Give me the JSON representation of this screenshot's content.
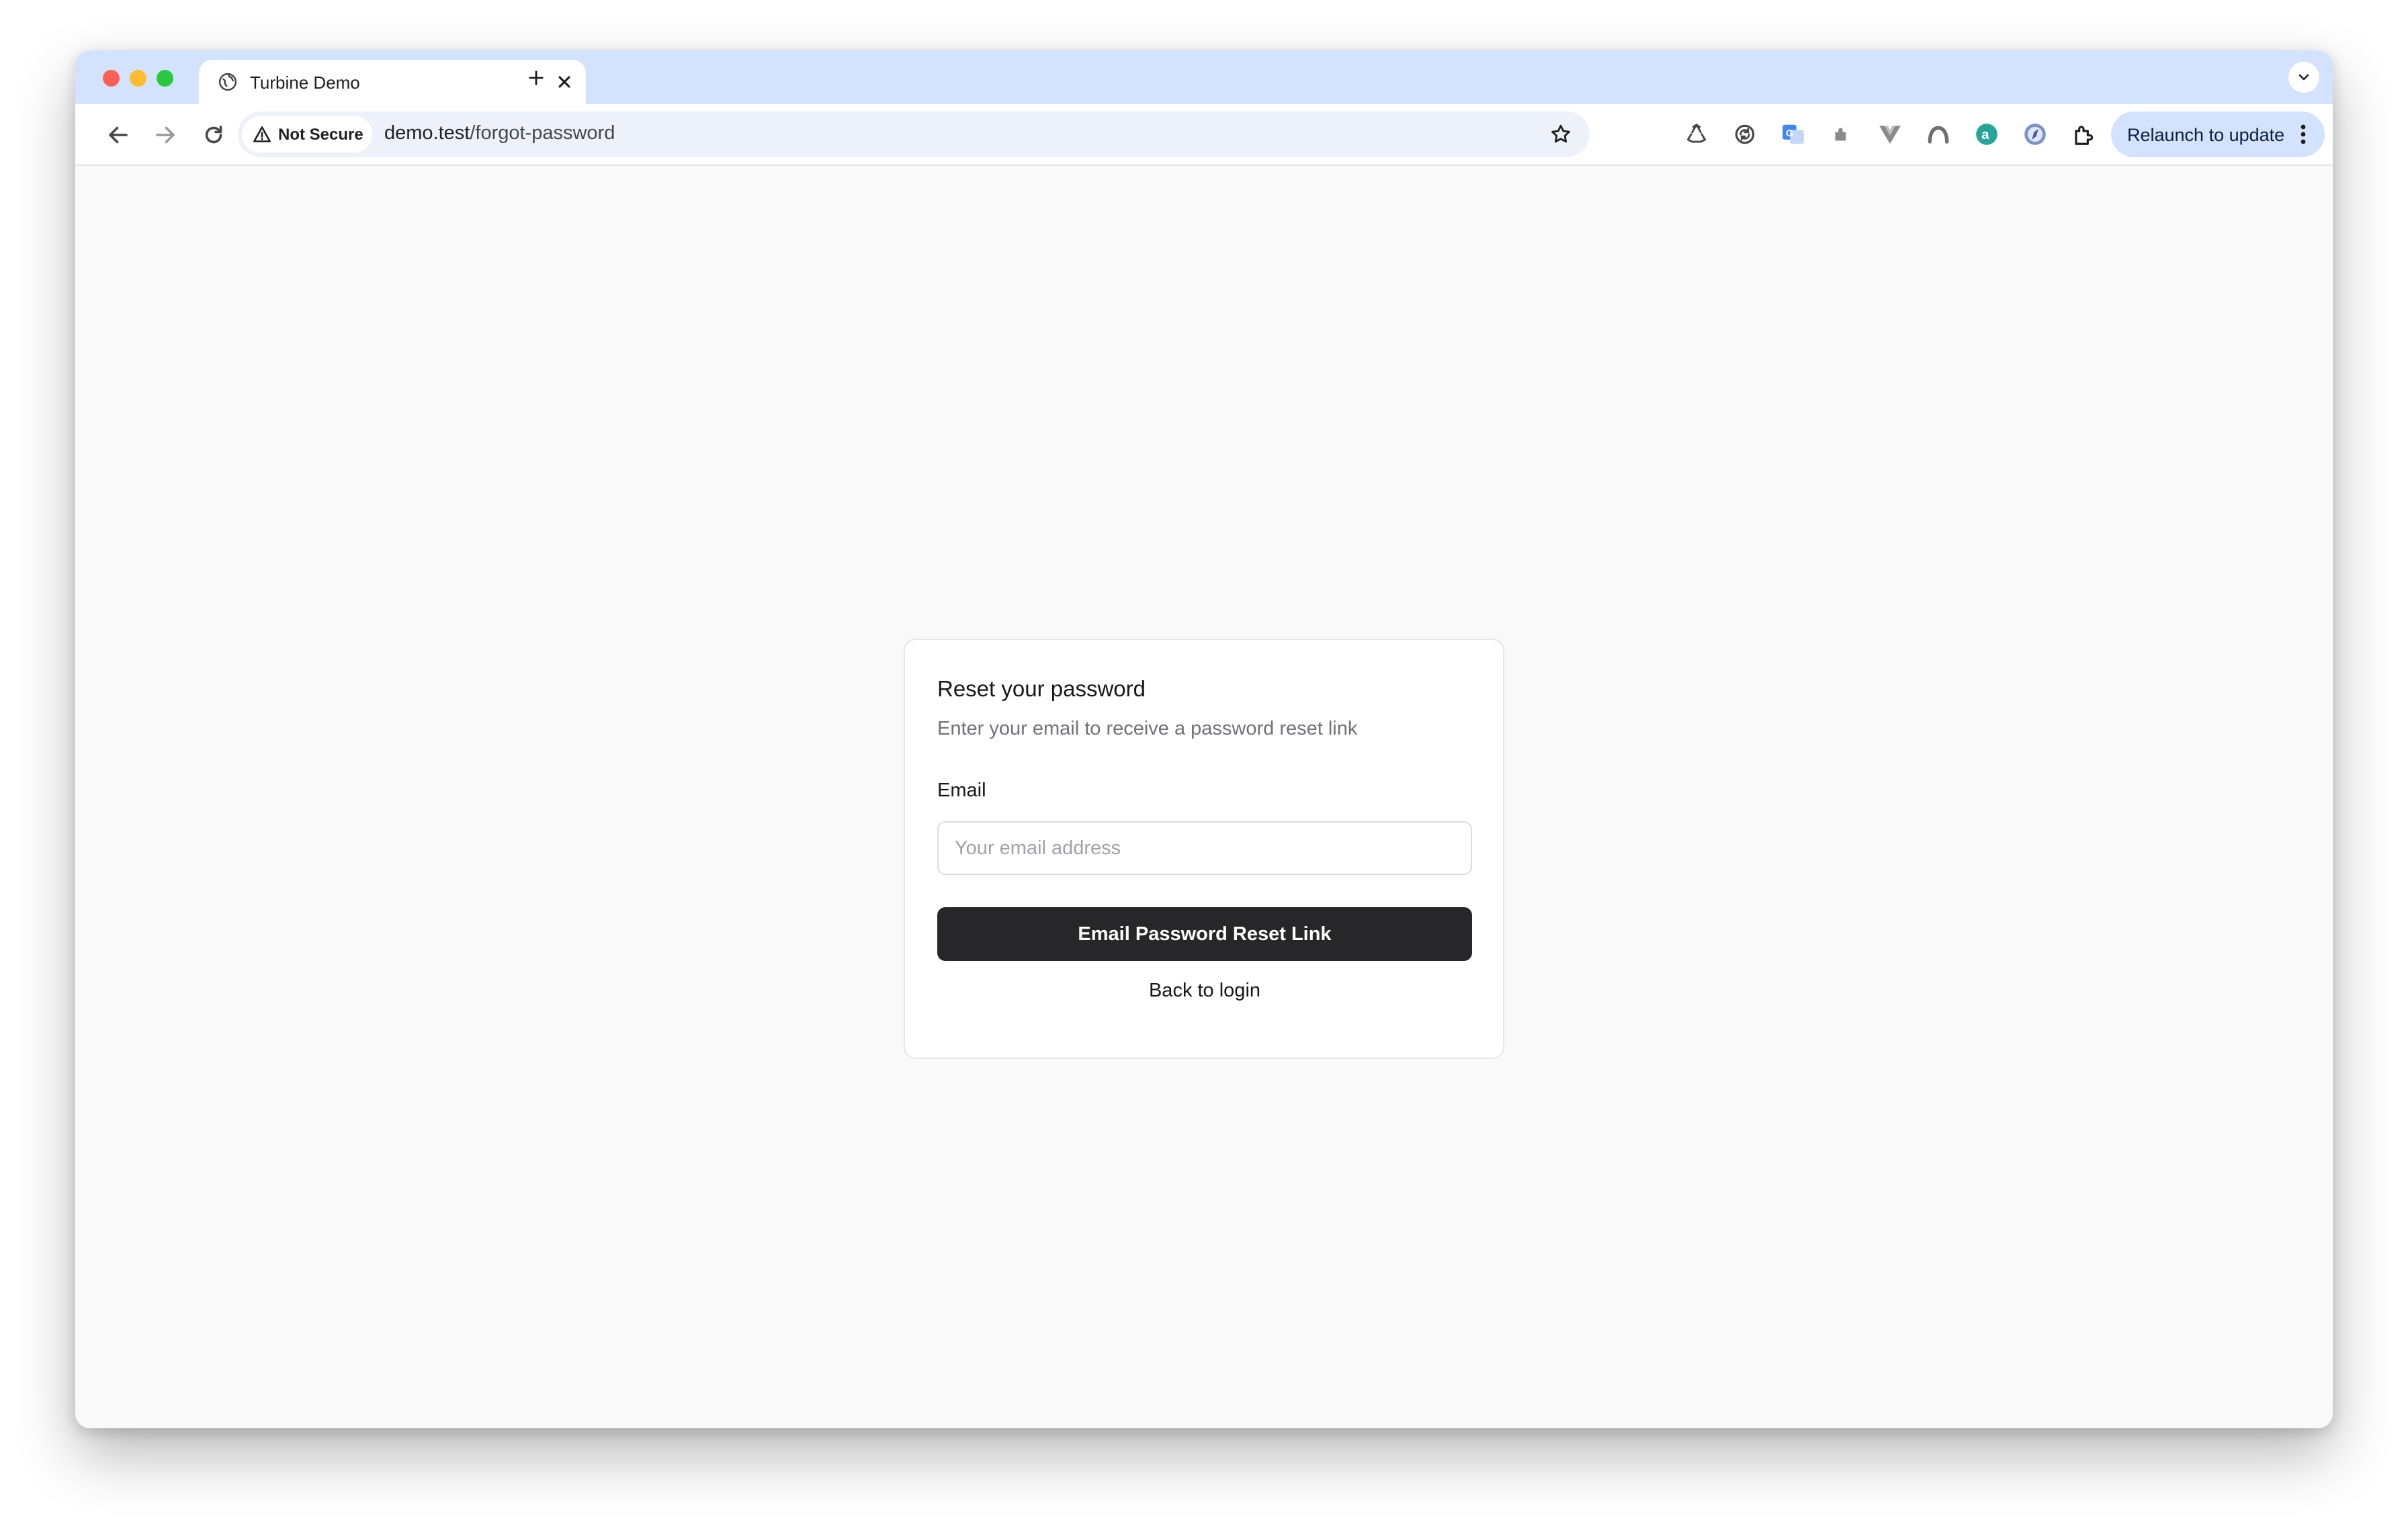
{
  "browser": {
    "tab": {
      "title": "Turbine Demo"
    },
    "security_chip": "Not Secure",
    "url": {
      "host": "demo.test",
      "path": "/forgot-password"
    },
    "relaunch_label": "Relaunch to update",
    "extension_icons": [
      "recycle-extension-icon",
      "refresh-extension-icon",
      "translate-extension-icon",
      "puzzle-piece-extension-icon",
      "vue-devtools-extension-icon",
      "arc-extension-icon",
      "a-badge-extension-icon",
      "compass-extension-icon",
      "extensions-menu-icon"
    ],
    "colors": {
      "tabstrip": "#d3e3fd",
      "toolbar": "#ffffff",
      "omnibox": "#edf2fa"
    }
  },
  "card": {
    "title": "Reset your password",
    "subtitle": "Enter your email to receive a password reset link",
    "email_label": "Email",
    "email_placeholder": "Your email address",
    "email_value": "",
    "submit_label": "Email Password Reset Link",
    "back_link": "Back to login"
  },
  "colors": {
    "page_background": "#f9f9f9",
    "button_background": "#27272a",
    "button_text": "#ffffff"
  }
}
